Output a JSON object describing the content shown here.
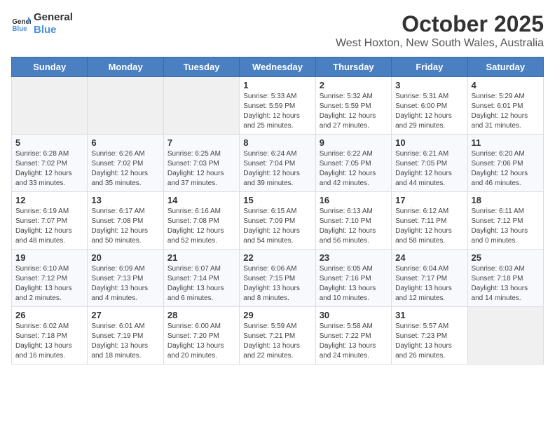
{
  "logo": {
    "line1": "General",
    "line2": "Blue"
  },
  "title": "October 2025",
  "location": "West Hoxton, New South Wales, Australia",
  "days_header": [
    "Sunday",
    "Monday",
    "Tuesday",
    "Wednesday",
    "Thursday",
    "Friday",
    "Saturday"
  ],
  "weeks": [
    [
      {
        "num": "",
        "info": ""
      },
      {
        "num": "",
        "info": ""
      },
      {
        "num": "",
        "info": ""
      },
      {
        "num": "1",
        "info": "Sunrise: 5:33 AM\nSunset: 5:59 PM\nDaylight: 12 hours\nand 25 minutes."
      },
      {
        "num": "2",
        "info": "Sunrise: 5:32 AM\nSunset: 5:59 PM\nDaylight: 12 hours\nand 27 minutes."
      },
      {
        "num": "3",
        "info": "Sunrise: 5:31 AM\nSunset: 6:00 PM\nDaylight: 12 hours\nand 29 minutes."
      },
      {
        "num": "4",
        "info": "Sunrise: 5:29 AM\nSunset: 6:01 PM\nDaylight: 12 hours\nand 31 minutes."
      }
    ],
    [
      {
        "num": "5",
        "info": "Sunrise: 6:28 AM\nSunset: 7:02 PM\nDaylight: 12 hours\nand 33 minutes."
      },
      {
        "num": "6",
        "info": "Sunrise: 6:26 AM\nSunset: 7:02 PM\nDaylight: 12 hours\nand 35 minutes."
      },
      {
        "num": "7",
        "info": "Sunrise: 6:25 AM\nSunset: 7:03 PM\nDaylight: 12 hours\nand 37 minutes."
      },
      {
        "num": "8",
        "info": "Sunrise: 6:24 AM\nSunset: 7:04 PM\nDaylight: 12 hours\nand 39 minutes."
      },
      {
        "num": "9",
        "info": "Sunrise: 6:22 AM\nSunset: 7:05 PM\nDaylight: 12 hours\nand 42 minutes."
      },
      {
        "num": "10",
        "info": "Sunrise: 6:21 AM\nSunset: 7:05 PM\nDaylight: 12 hours\nand 44 minutes."
      },
      {
        "num": "11",
        "info": "Sunrise: 6:20 AM\nSunset: 7:06 PM\nDaylight: 12 hours\nand 46 minutes."
      }
    ],
    [
      {
        "num": "12",
        "info": "Sunrise: 6:19 AM\nSunset: 7:07 PM\nDaylight: 12 hours\nand 48 minutes."
      },
      {
        "num": "13",
        "info": "Sunrise: 6:17 AM\nSunset: 7:08 PM\nDaylight: 12 hours\nand 50 minutes."
      },
      {
        "num": "14",
        "info": "Sunrise: 6:16 AM\nSunset: 7:08 PM\nDaylight: 12 hours\nand 52 minutes."
      },
      {
        "num": "15",
        "info": "Sunrise: 6:15 AM\nSunset: 7:09 PM\nDaylight: 12 hours\nand 54 minutes."
      },
      {
        "num": "16",
        "info": "Sunrise: 6:13 AM\nSunset: 7:10 PM\nDaylight: 12 hours\nand 56 minutes."
      },
      {
        "num": "17",
        "info": "Sunrise: 6:12 AM\nSunset: 7:11 PM\nDaylight: 12 hours\nand 58 minutes."
      },
      {
        "num": "18",
        "info": "Sunrise: 6:11 AM\nSunset: 7:12 PM\nDaylight: 13 hours\nand 0 minutes."
      }
    ],
    [
      {
        "num": "19",
        "info": "Sunrise: 6:10 AM\nSunset: 7:12 PM\nDaylight: 13 hours\nand 2 minutes."
      },
      {
        "num": "20",
        "info": "Sunrise: 6:09 AM\nSunset: 7:13 PM\nDaylight: 13 hours\nand 4 minutes."
      },
      {
        "num": "21",
        "info": "Sunrise: 6:07 AM\nSunset: 7:14 PM\nDaylight: 13 hours\nand 6 minutes."
      },
      {
        "num": "22",
        "info": "Sunrise: 6:06 AM\nSunset: 7:15 PM\nDaylight: 13 hours\nand 8 minutes."
      },
      {
        "num": "23",
        "info": "Sunrise: 6:05 AM\nSunset: 7:16 PM\nDaylight: 13 hours\nand 10 minutes."
      },
      {
        "num": "24",
        "info": "Sunrise: 6:04 AM\nSunset: 7:17 PM\nDaylight: 13 hours\nand 12 minutes."
      },
      {
        "num": "25",
        "info": "Sunrise: 6:03 AM\nSunset: 7:18 PM\nDaylight: 13 hours\nand 14 minutes."
      }
    ],
    [
      {
        "num": "26",
        "info": "Sunrise: 6:02 AM\nSunset: 7:18 PM\nDaylight: 13 hours\nand 16 minutes."
      },
      {
        "num": "27",
        "info": "Sunrise: 6:01 AM\nSunset: 7:19 PM\nDaylight: 13 hours\nand 18 minutes."
      },
      {
        "num": "28",
        "info": "Sunrise: 6:00 AM\nSunset: 7:20 PM\nDaylight: 13 hours\nand 20 minutes."
      },
      {
        "num": "29",
        "info": "Sunrise: 5:59 AM\nSunset: 7:21 PM\nDaylight: 13 hours\nand 22 minutes."
      },
      {
        "num": "30",
        "info": "Sunrise: 5:58 AM\nSunset: 7:22 PM\nDaylight: 13 hours\nand 24 minutes."
      },
      {
        "num": "31",
        "info": "Sunrise: 5:57 AM\nSunset: 7:23 PM\nDaylight: 13 hours\nand 26 minutes."
      },
      {
        "num": "",
        "info": ""
      }
    ]
  ]
}
